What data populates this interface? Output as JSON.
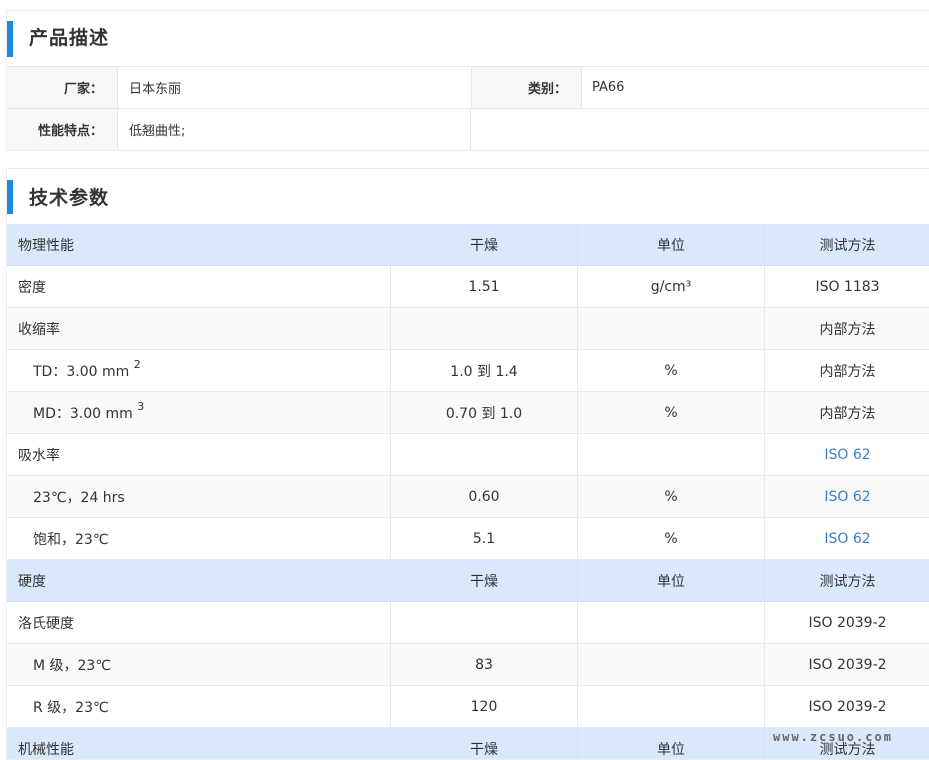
{
  "product_desc": {
    "title": "产品描述",
    "manufacturer_label": "厂家：",
    "manufacturer": "日本东丽",
    "category_label": "类别：",
    "category": "PA66",
    "features_label": "性能特点：",
    "features": "低翘曲性;"
  },
  "tech_params": {
    "title": "技术参数",
    "rows": [
      {
        "type": "header",
        "c1": "物理性能",
        "c2": "干燥",
        "c3": "单位",
        "c4": "测试方法"
      },
      {
        "type": "row",
        "c1": "密度",
        "c2": "1.51",
        "c3": "g/cm³",
        "c4": "ISO 1183"
      },
      {
        "type": "row",
        "c1": "收缩率",
        "c2": "",
        "c3": "",
        "c4": "内部方法"
      },
      {
        "type": "sub",
        "c1": "TD：3.00 mm",
        "sup": "2",
        "c2": "1.0 到 1.4",
        "c3": "%",
        "c4": "内部方法"
      },
      {
        "type": "sub",
        "c1": "MD：3.00 mm",
        "sup": "3",
        "c2": "0.70 到 1.0",
        "c3": "%",
        "c4": "内部方法"
      },
      {
        "type": "row",
        "c1": "吸水率",
        "c2": "",
        "c3": "",
        "c4": "ISO 62",
        "link": true
      },
      {
        "type": "sub",
        "c1": "23℃，24 hrs",
        "c2": "0.60",
        "c3": "%",
        "c4": "ISO 62",
        "link": true
      },
      {
        "type": "sub",
        "c1": "饱和，23℃",
        "c2": "5.1",
        "c3": "%",
        "c4": "ISO 62",
        "link": true
      },
      {
        "type": "header",
        "c1": "硬度",
        "c2": "干燥",
        "c3": "单位",
        "c4": "测试方法"
      },
      {
        "type": "row",
        "c1": "洛氏硬度",
        "c2": "",
        "c3": "",
        "c4": "ISO 2039-2"
      },
      {
        "type": "sub",
        "c1": "M 级，23℃",
        "c2": "83",
        "c3": "",
        "c4": "ISO 2039-2"
      },
      {
        "type": "sub",
        "c1": "R 级，23℃",
        "c2": "120",
        "c3": "",
        "c4": "ISO 2039-2"
      },
      {
        "type": "header",
        "c1": "机械性能",
        "c2": "干燥",
        "c3": "单位",
        "c4": "测试方法"
      }
    ]
  },
  "watermark": "www.zcsuo.com"
}
